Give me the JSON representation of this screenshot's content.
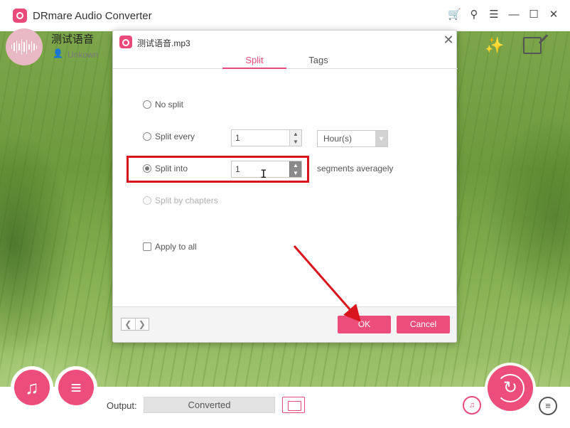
{
  "window": {
    "title": "DRmare Audio Converter"
  },
  "track": {
    "title": "测试语音",
    "artist": "Unkown"
  },
  "dialog": {
    "title": "测试语音.mp3",
    "tabs": [
      {
        "label": "Split",
        "active": true
      },
      {
        "label": "Tags",
        "active": false
      }
    ],
    "options": {
      "no_split": "No split",
      "split_every": "Split every",
      "split_every_value": "1",
      "split_unit": "Hour(s)",
      "split_into": "Split into",
      "split_into_value": "1",
      "segments_label": "segments averagely",
      "split_by_chapters": "Split by chapters",
      "apply_to_all": "Apply to all",
      "selected": "split_into"
    },
    "buttons": {
      "ok": "OK",
      "cancel": "Cancel"
    }
  },
  "bottom": {
    "output_label": "Output:",
    "output_value": "Converted"
  },
  "colors": {
    "accent": "#ec4d7b",
    "highlight": "#d9141c"
  }
}
